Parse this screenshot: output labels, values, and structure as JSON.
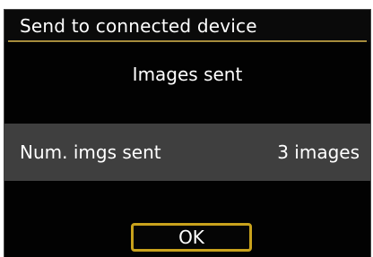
{
  "dialog": {
    "title": "Send to connected device",
    "subtitle": "Images sent",
    "info": {
      "label": "Num. imgs sent",
      "value": "3 images"
    },
    "ok_label": "OK"
  },
  "colors": {
    "background": "#020202",
    "title_underline": "#a68c3c",
    "info_row": "#3f3f3f",
    "button_border": "#c9a21c",
    "text": "#ffffff"
  }
}
